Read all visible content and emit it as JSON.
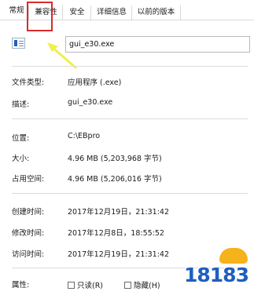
{
  "tabs": [
    {
      "label": "常规"
    },
    {
      "label": "兼容性"
    },
    {
      "label": "安全"
    },
    {
      "label": "详细信息"
    },
    {
      "label": "以前的版本"
    }
  ],
  "file_name": "gui_e30.exe",
  "fields": {
    "file_type": {
      "label": "文件类型:",
      "value": "应用程序 (.exe)"
    },
    "description": {
      "label": "描述:",
      "value": "gui_e30.exe"
    },
    "location": {
      "label": "位置:",
      "value": "C:\\EBpro"
    },
    "size": {
      "label": "大小:",
      "value": "4.96 MB (5,203,968 字节)"
    },
    "size_on_disk": {
      "label": "占用空间:",
      "value": "4.96 MB (5,206,016 字节)"
    },
    "created": {
      "label": "创建时间:",
      "value": "2017年12月19日，21:31:42"
    },
    "modified": {
      "label": "修改时间:",
      "value": "2017年12月8日，18:55:52"
    },
    "accessed": {
      "label": "访问时间:",
      "value": "2017年12月19日，21:31:42"
    }
  },
  "attributes": {
    "label": "属性:",
    "readonly_label": "只读(R)",
    "readonly_checked": false,
    "hidden_label": "隐藏(H)",
    "hidden_checked": false
  },
  "watermark": {
    "text": "18183"
  },
  "colors": {
    "highlight_box": "#d92b2b",
    "arrow": "#f2ee4a",
    "logo_blue": "#1d5fbf"
  }
}
